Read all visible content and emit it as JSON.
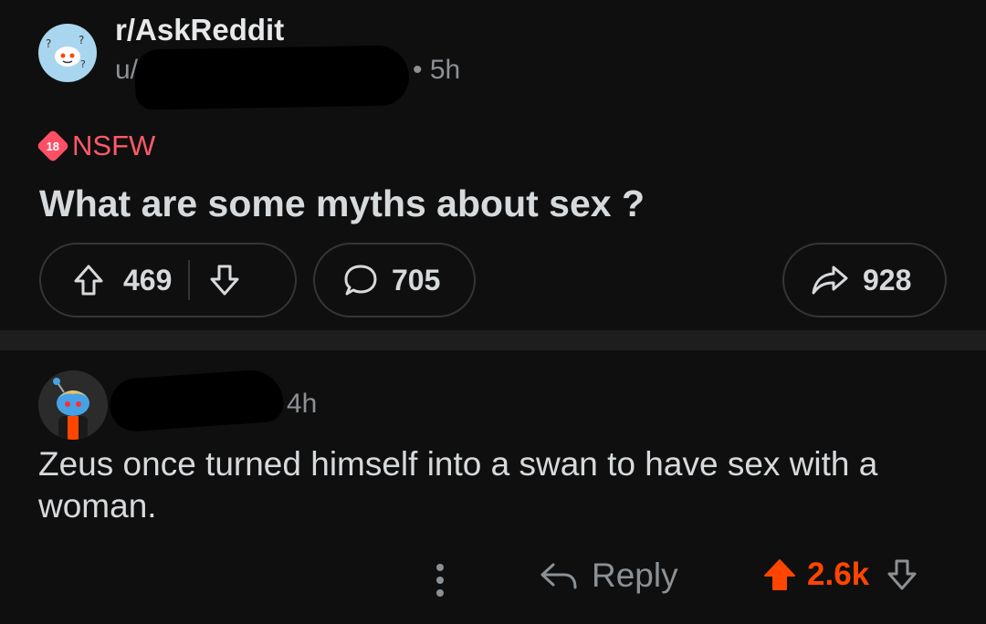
{
  "post": {
    "subreddit": "r/AskReddit",
    "user_prefix": "u/",
    "time": "• 5h",
    "nsfw_badge": "18",
    "nsfw_label": "NSFW",
    "title": "What are some myths about sex ?",
    "upvotes": "469",
    "comments": "705",
    "shares": "928"
  },
  "comment": {
    "time": "4h",
    "text": "Zeus once turned himself into a swan to have sex with a woman.",
    "reply_label": "Reply",
    "score": "2.6k"
  },
  "colors": {
    "background": "#0f0f0f",
    "accent_upvote": "#ff4500",
    "nsfw": "#ff5969",
    "muted": "#8c9196"
  }
}
